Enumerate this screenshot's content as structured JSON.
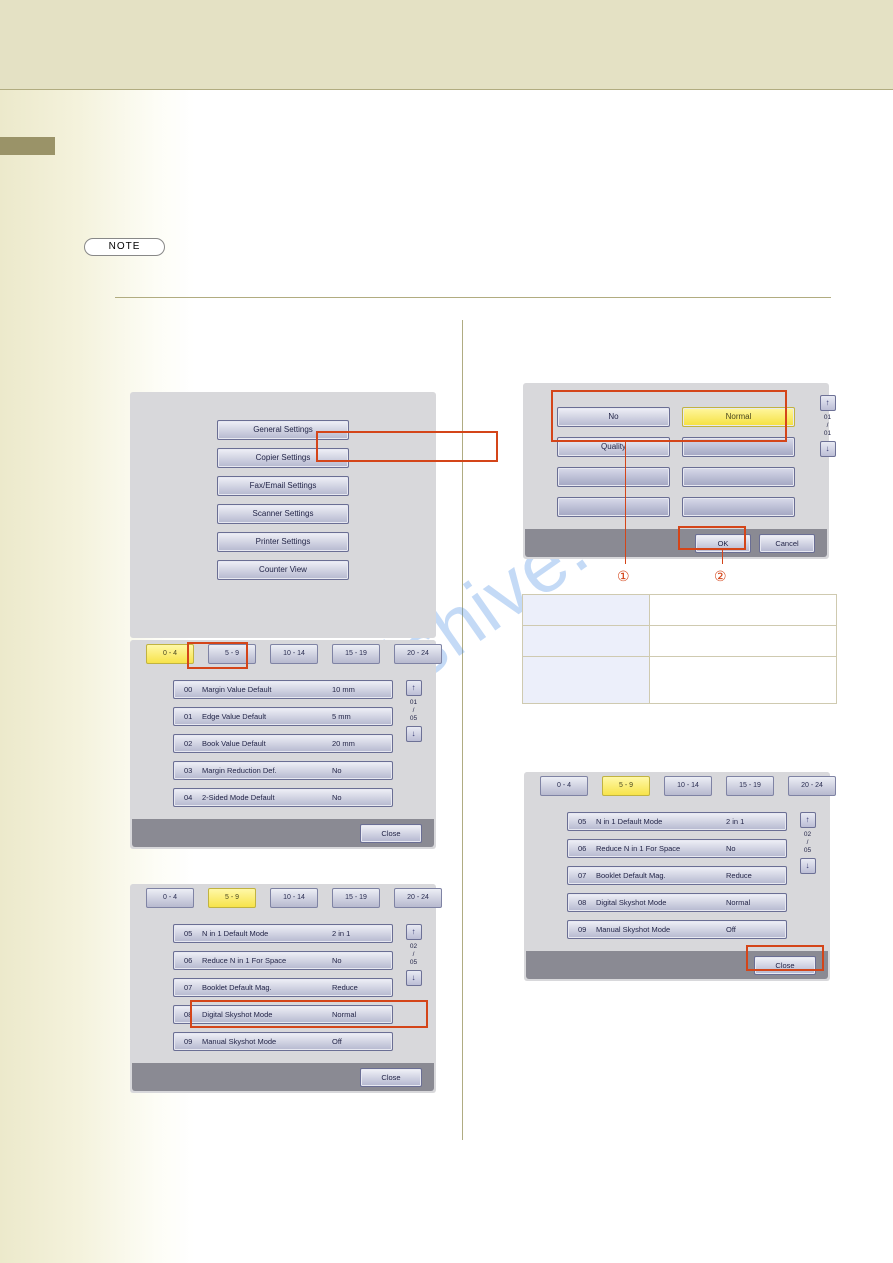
{
  "watermark": "manualshive.com",
  "badges": {
    "note": "NOTE"
  },
  "buttons": {
    "ok": "OK",
    "cancel": "Cancel",
    "close": "Close"
  },
  "callouts": {
    "c1": "①",
    "c2": "②"
  },
  "tabs": [
    "0 - 4",
    "5 - 9",
    "10 - 14",
    "15 - 19",
    "20 - 24"
  ],
  "panel1": {
    "items": [
      "General Settings",
      "Copier Settings",
      "Fax/Email Settings",
      "Scanner Settings",
      "Printer Settings",
      "Counter View"
    ]
  },
  "panel2": {
    "page": {
      "cur": "01",
      "tot": "05"
    },
    "rows": [
      {
        "num": "00",
        "label": "Margin Value Default",
        "value": "10 mm"
      },
      {
        "num": "01",
        "label": "Edge Value Default",
        "value": "5 mm"
      },
      {
        "num": "02",
        "label": "Book Value Default",
        "value": "20 mm"
      },
      {
        "num": "03",
        "label": "Margin Reduction Def.",
        "value": "No"
      },
      {
        "num": "04",
        "label": "2-Sided Mode Default",
        "value": "No"
      }
    ]
  },
  "panel3": {
    "page": {
      "cur": "02",
      "tot": "05"
    },
    "rows": [
      {
        "num": "05",
        "label": "N in 1 Default Mode",
        "value": "2 in 1"
      },
      {
        "num": "06",
        "label": "Reduce N in 1 For Space",
        "value": "No"
      },
      {
        "num": "07",
        "label": "Booklet Default Mag.",
        "value": "Reduce"
      },
      {
        "num": "08",
        "label": "Digital Skyshot Mode",
        "value": "Normal"
      },
      {
        "num": "09",
        "label": "Manual Skyshot Mode",
        "value": "Off"
      }
    ]
  },
  "panel4": {
    "page": {
      "cur": "01",
      "tot": "01"
    },
    "opts": [
      "No",
      "Normal",
      "Quality"
    ]
  }
}
